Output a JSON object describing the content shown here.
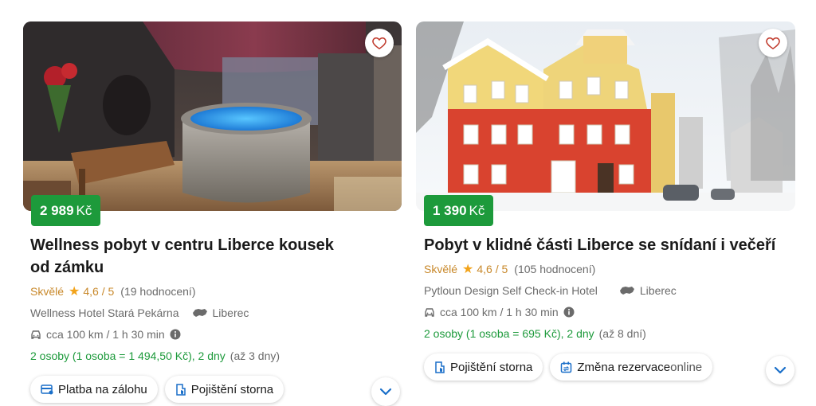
{
  "cards": [
    {
      "price": "2 989",
      "currency": "Kč",
      "title": "Wellness pobyt v centru Liberce kousek od zámku",
      "rating_word": "Skvělé",
      "rating_score": "4,6 / 5",
      "rating_count": "(19 hodnocení)",
      "hotel": "Wellness Hotel Stará Pekárna",
      "location": "Liberec",
      "distance": "cca 100 km / 1 h 30 min",
      "occupancy": "2 osoby (1 osoba = 1 494,50 Kč), 2 dny",
      "duration_note": "(až 3 dny)",
      "chips": [
        "Platba na zálohu",
        "Pojištění storna"
      ],
      "favorite_icon": "heart-outline-icon"
    },
    {
      "price": "1 390",
      "currency": "Kč",
      "title": "Pobyt v klidné části Liberce se snídaní i večeří",
      "rating_word": "Skvělé",
      "rating_score": "4,6 / 5",
      "rating_count": "(105 hodnocení)",
      "hotel": "Pytloun Design Self Check-in Hotel",
      "location": "Liberec",
      "distance": "cca 100 km / 1 h 30 min",
      "occupancy": "2 osoby (1 osoba = 695 Kč), 2 dny",
      "duration_note": "(až 8 dní)",
      "chips": [
        "Pojištění storna",
        "Změna rezervace ",
        "online"
      ],
      "favorite_icon": "heart-outline-icon"
    }
  ],
  "colors": {
    "price_badge": "#1d9a3b",
    "rating_word": "#c8882a",
    "star": "#f2a31a",
    "accent_blue": "#1a6fc9",
    "heart": "#c0392b"
  }
}
